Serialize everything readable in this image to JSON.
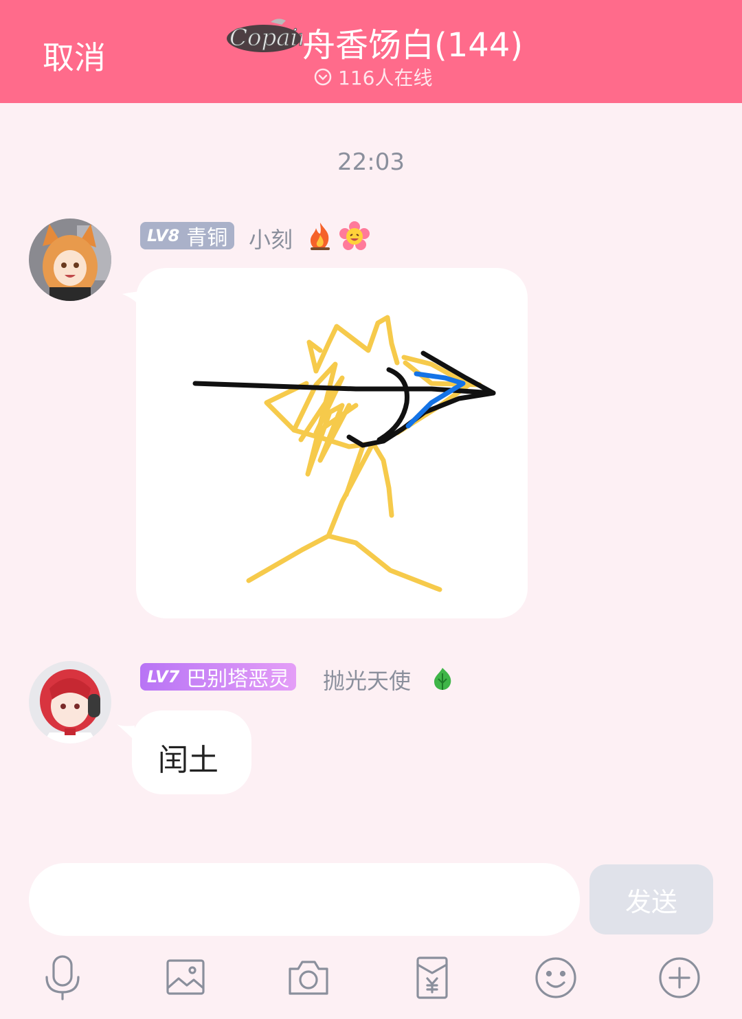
{
  "header": {
    "cancel_label": "取消",
    "logo_text": "Copain",
    "title": "舟香饧白(144)",
    "online_text": "116人在线"
  },
  "timestamp": "22:03",
  "messages": [
    {
      "level": "LV8",
      "badge_title": "青铜",
      "nickname": "小刻",
      "content_type": "drawing"
    },
    {
      "level": "LV7",
      "badge_title": "巴别塔恶灵",
      "nickname": "抛光天使",
      "text": "闰土"
    }
  ],
  "composer": {
    "input_value": "",
    "send_label": "发送"
  },
  "toolbar": {
    "icons": [
      "microphone-icon",
      "image-icon",
      "camera-icon",
      "red-packet-icon",
      "emoji-icon",
      "plus-icon"
    ]
  },
  "colors": {
    "header_bg": "#ff6b8b",
    "page_bg": "#fdf0f4",
    "badge_bronze": "#aab1c9",
    "badge_purple": "#c183f6",
    "send_disabled": "#e0e2ea"
  }
}
